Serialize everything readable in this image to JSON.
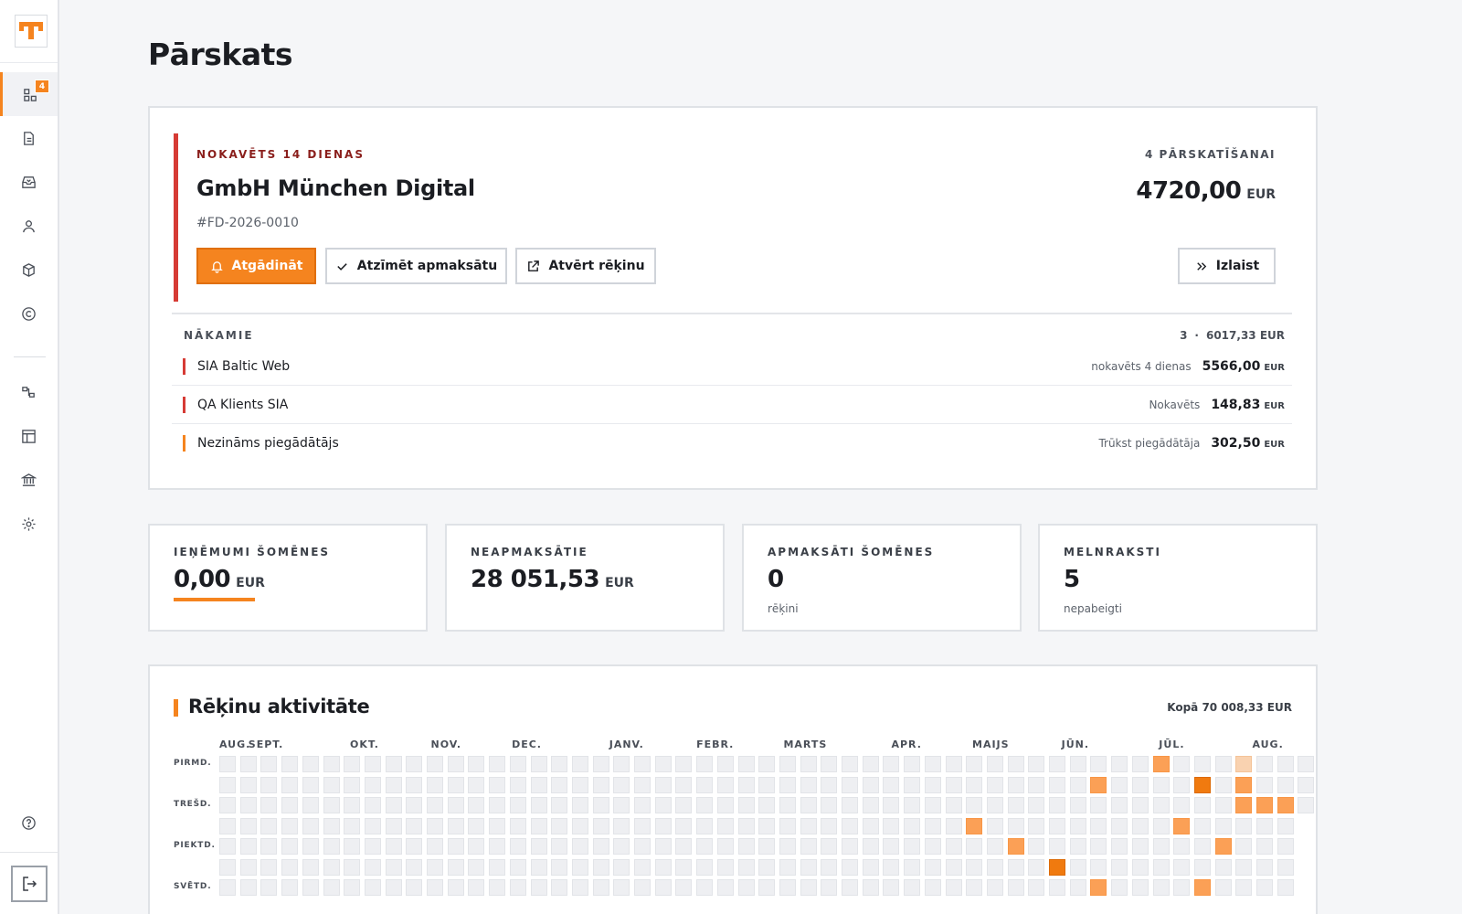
{
  "app": {
    "page_title": "Pārskats"
  },
  "sidebar": {
    "badge_count": "4",
    "items": [
      {
        "name": "dashboard-icon",
        "active": true
      },
      {
        "name": "document-icon"
      },
      {
        "name": "inbox-icon"
      },
      {
        "name": "user-icon"
      },
      {
        "name": "box-icon"
      },
      {
        "name": "copyright-icon"
      },
      {
        "name": "workflow-icon"
      },
      {
        "name": "layout-icon"
      },
      {
        "name": "bank-icon"
      },
      {
        "name": "settings-icon"
      }
    ]
  },
  "overdue": {
    "status_label": "NOKAVĒTS 14 DIENAS",
    "client_name": "GmbH München Digital",
    "invoice_id": "#FD-2026-0010",
    "review_count_label": "4 PĀRSKATĪŠANAI",
    "amount": "4720,00",
    "currency": "EUR",
    "buttons": {
      "remind": "Atgādināt",
      "mark_paid": "Atzīmēt apmaksātu",
      "open_invoice": "Atvērt rēķinu",
      "skip": "Izlaist"
    }
  },
  "upcoming": {
    "label": "NĀKAMIE",
    "count": "3",
    "separator": "·",
    "total": "6017,33 EUR",
    "rows": [
      {
        "name": "SIA Baltic Web",
        "status": "nokavēts 4 dienas",
        "amount": "5566,00",
        "currency": "EUR",
        "color": "#d63b35"
      },
      {
        "name": "QA Klients SIA",
        "status": "Nokavēts",
        "amount": "148,83",
        "currency": "EUR",
        "color": "#d63b35"
      },
      {
        "name": "Nezināms piegādātājs",
        "status": "Trūkst piegādātāja",
        "amount": "302,50",
        "currency": "EUR",
        "color": "#f5841f"
      }
    ]
  },
  "kpis": [
    {
      "label": "IEŅĒMUMI ŠOMĒNES",
      "value": "0,00",
      "currency": "EUR",
      "sub": ""
    },
    {
      "label": "NEAPMAKSĀTIE",
      "value": "28 051,53",
      "currency": "EUR",
      "sub": ""
    },
    {
      "label": "APMAKSĀTI ŠOMĒNES",
      "value": "0",
      "currency": "",
      "sub": "rēķini"
    },
    {
      "label": "MELNRAKSTI",
      "value": "5",
      "currency": "",
      "sub": "nepabeigti"
    }
  ],
  "activity": {
    "title": "Rēķinu aktivitāte",
    "total": "Kopā 70 008,33 EUR",
    "day_labels": [
      "PIRMD.",
      "TREŠD.",
      "PIEKTD.",
      "SVĒTD."
    ],
    "months": [
      {
        "label": "AUG.",
        "col": 0
      },
      {
        "label": "SEPT.",
        "col": 1.4
      },
      {
        "label": "OKT.",
        "col": 6.3
      },
      {
        "label": "NOV.",
        "col": 10.2
      },
      {
        "label": "DEC.",
        "col": 14.1
      },
      {
        "label": "JANV.",
        "col": 18.8
      },
      {
        "label": "FEBR.",
        "col": 23
      },
      {
        "label": "MARTS",
        "col": 27.2
      },
      {
        "label": "APR.",
        "col": 32.4
      },
      {
        "label": "MAIJS",
        "col": 36.3
      },
      {
        "label": "JŪN.",
        "col": 40.6
      },
      {
        "label": "JŪL.",
        "col": 45.3
      },
      {
        "label": "AUG.",
        "col": 49.8
      }
    ],
    "weeks": 53,
    "active_cells": [
      {
        "col": 45,
        "row": 0,
        "level": 2
      },
      {
        "col": 49,
        "row": 0,
        "level": 1
      },
      {
        "col": 42,
        "row": 1,
        "level": 2
      },
      {
        "col": 47,
        "row": 1,
        "level": 4
      },
      {
        "col": 49,
        "row": 1,
        "level": 2
      },
      {
        "col": 49,
        "row": 2,
        "level": 2
      },
      {
        "col": 50,
        "row": 2,
        "level": 2
      },
      {
        "col": 51,
        "row": 2,
        "level": 2
      },
      {
        "col": 36,
        "row": 3,
        "level": 2
      },
      {
        "col": 46,
        "row": 3,
        "level": 2
      },
      {
        "col": 38,
        "row": 4,
        "level": 2
      },
      {
        "col": 48,
        "row": 4,
        "level": 2
      },
      {
        "col": 40,
        "row": 5,
        "level": 4
      },
      {
        "col": 42,
        "row": 6,
        "level": 2
      },
      {
        "col": 47,
        "row": 6,
        "level": 2
      }
    ],
    "last_col_rows": 3
  },
  "colors": {
    "accent": "#f5841f",
    "danger": "#d63b35"
  }
}
